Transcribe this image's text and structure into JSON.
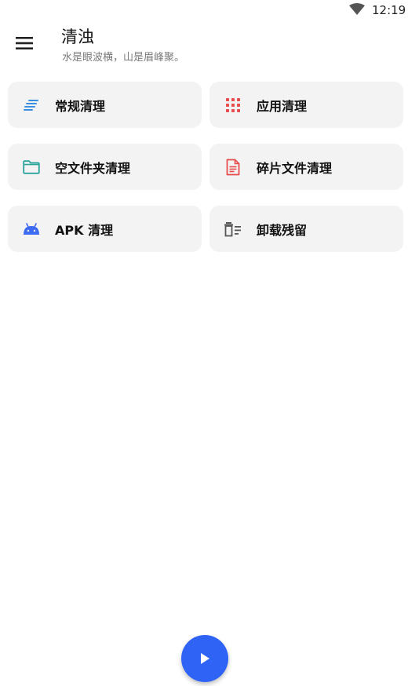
{
  "status": {
    "time": "12:19"
  },
  "header": {
    "title": "清浊",
    "subtitle": "水是眼波横，山是眉峰聚。"
  },
  "cards": [
    {
      "label": "常规清理",
      "icon": "lines-icon",
      "color": "#3a8fe0"
    },
    {
      "label": "应用清理",
      "icon": "apps-grid-icon",
      "color": "#e84c4c"
    },
    {
      "label": "空文件夹清理",
      "icon": "folder-icon",
      "color": "#2aa39a"
    },
    {
      "label": "碎片文件清理",
      "icon": "document-icon",
      "color": "#e84c4c"
    },
    {
      "label": "APK 清理",
      "icon": "android-icon",
      "color": "#3d6cf0"
    },
    {
      "label": "卸载残留",
      "icon": "delete-list-icon",
      "color": "#555555"
    }
  ],
  "fab": {
    "icon": "play-icon",
    "color": "#2e63f6"
  }
}
